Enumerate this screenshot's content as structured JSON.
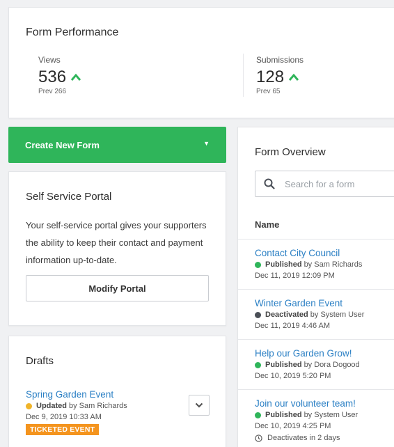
{
  "colors": {
    "accent_green": "#2fb55a",
    "link_blue": "#2a7fc4",
    "published_dot": "#2fb55a",
    "deactivated_dot": "#4a4f57",
    "updated_dot": "#f0b429",
    "ticket_badge": "#f4941e"
  },
  "performance": {
    "title": "Form Performance",
    "views": {
      "label": "Views",
      "value": "536",
      "prev": "Prev 266",
      "trend_icon": "up-arrow-icon"
    },
    "submissions": {
      "label": "Submissions",
      "value": "128",
      "prev": "Prev 65",
      "trend_icon": "up-arrow-icon"
    }
  },
  "create_button": {
    "label": "Create New Form",
    "caret_icon": "caret-down-icon"
  },
  "portal": {
    "title": "Self Service Portal",
    "description": "Your self-service portal gives your supporters the ability to keep their contact and payment information up-to-date.",
    "button_label": "Modify Portal"
  },
  "drafts": {
    "title": "Drafts",
    "items": [
      {
        "name": "Spring Garden Event",
        "status": "Updated",
        "by": "by Sam Richards",
        "date": "Dec 9, 2019 10:33 AM",
        "badge": "TICKETED EVENT"
      }
    ]
  },
  "overview": {
    "title": "Form Overview",
    "search_placeholder": "Search for a form",
    "column_name": "Name",
    "items": [
      {
        "name": "Contact City Council",
        "status": "Published",
        "by": "by Sam Richards",
        "date": "Dec 11, 2019 12:09 PM"
      },
      {
        "name": "Winter Garden Event",
        "status": "Deactivated",
        "by": "by System User",
        "date": "Dec 11, 2019 4:46 AM"
      },
      {
        "name": "Help our Garden Grow!",
        "status": "Published",
        "by": "by Dora Dogood",
        "date": "Dec 10, 2019 5:20 PM"
      },
      {
        "name": "Join our volunteer team!",
        "status": "Published",
        "by": "by System User",
        "date": "Dec 10, 2019 4:25 PM",
        "note": "Deactivates in 2 days"
      }
    ]
  }
}
